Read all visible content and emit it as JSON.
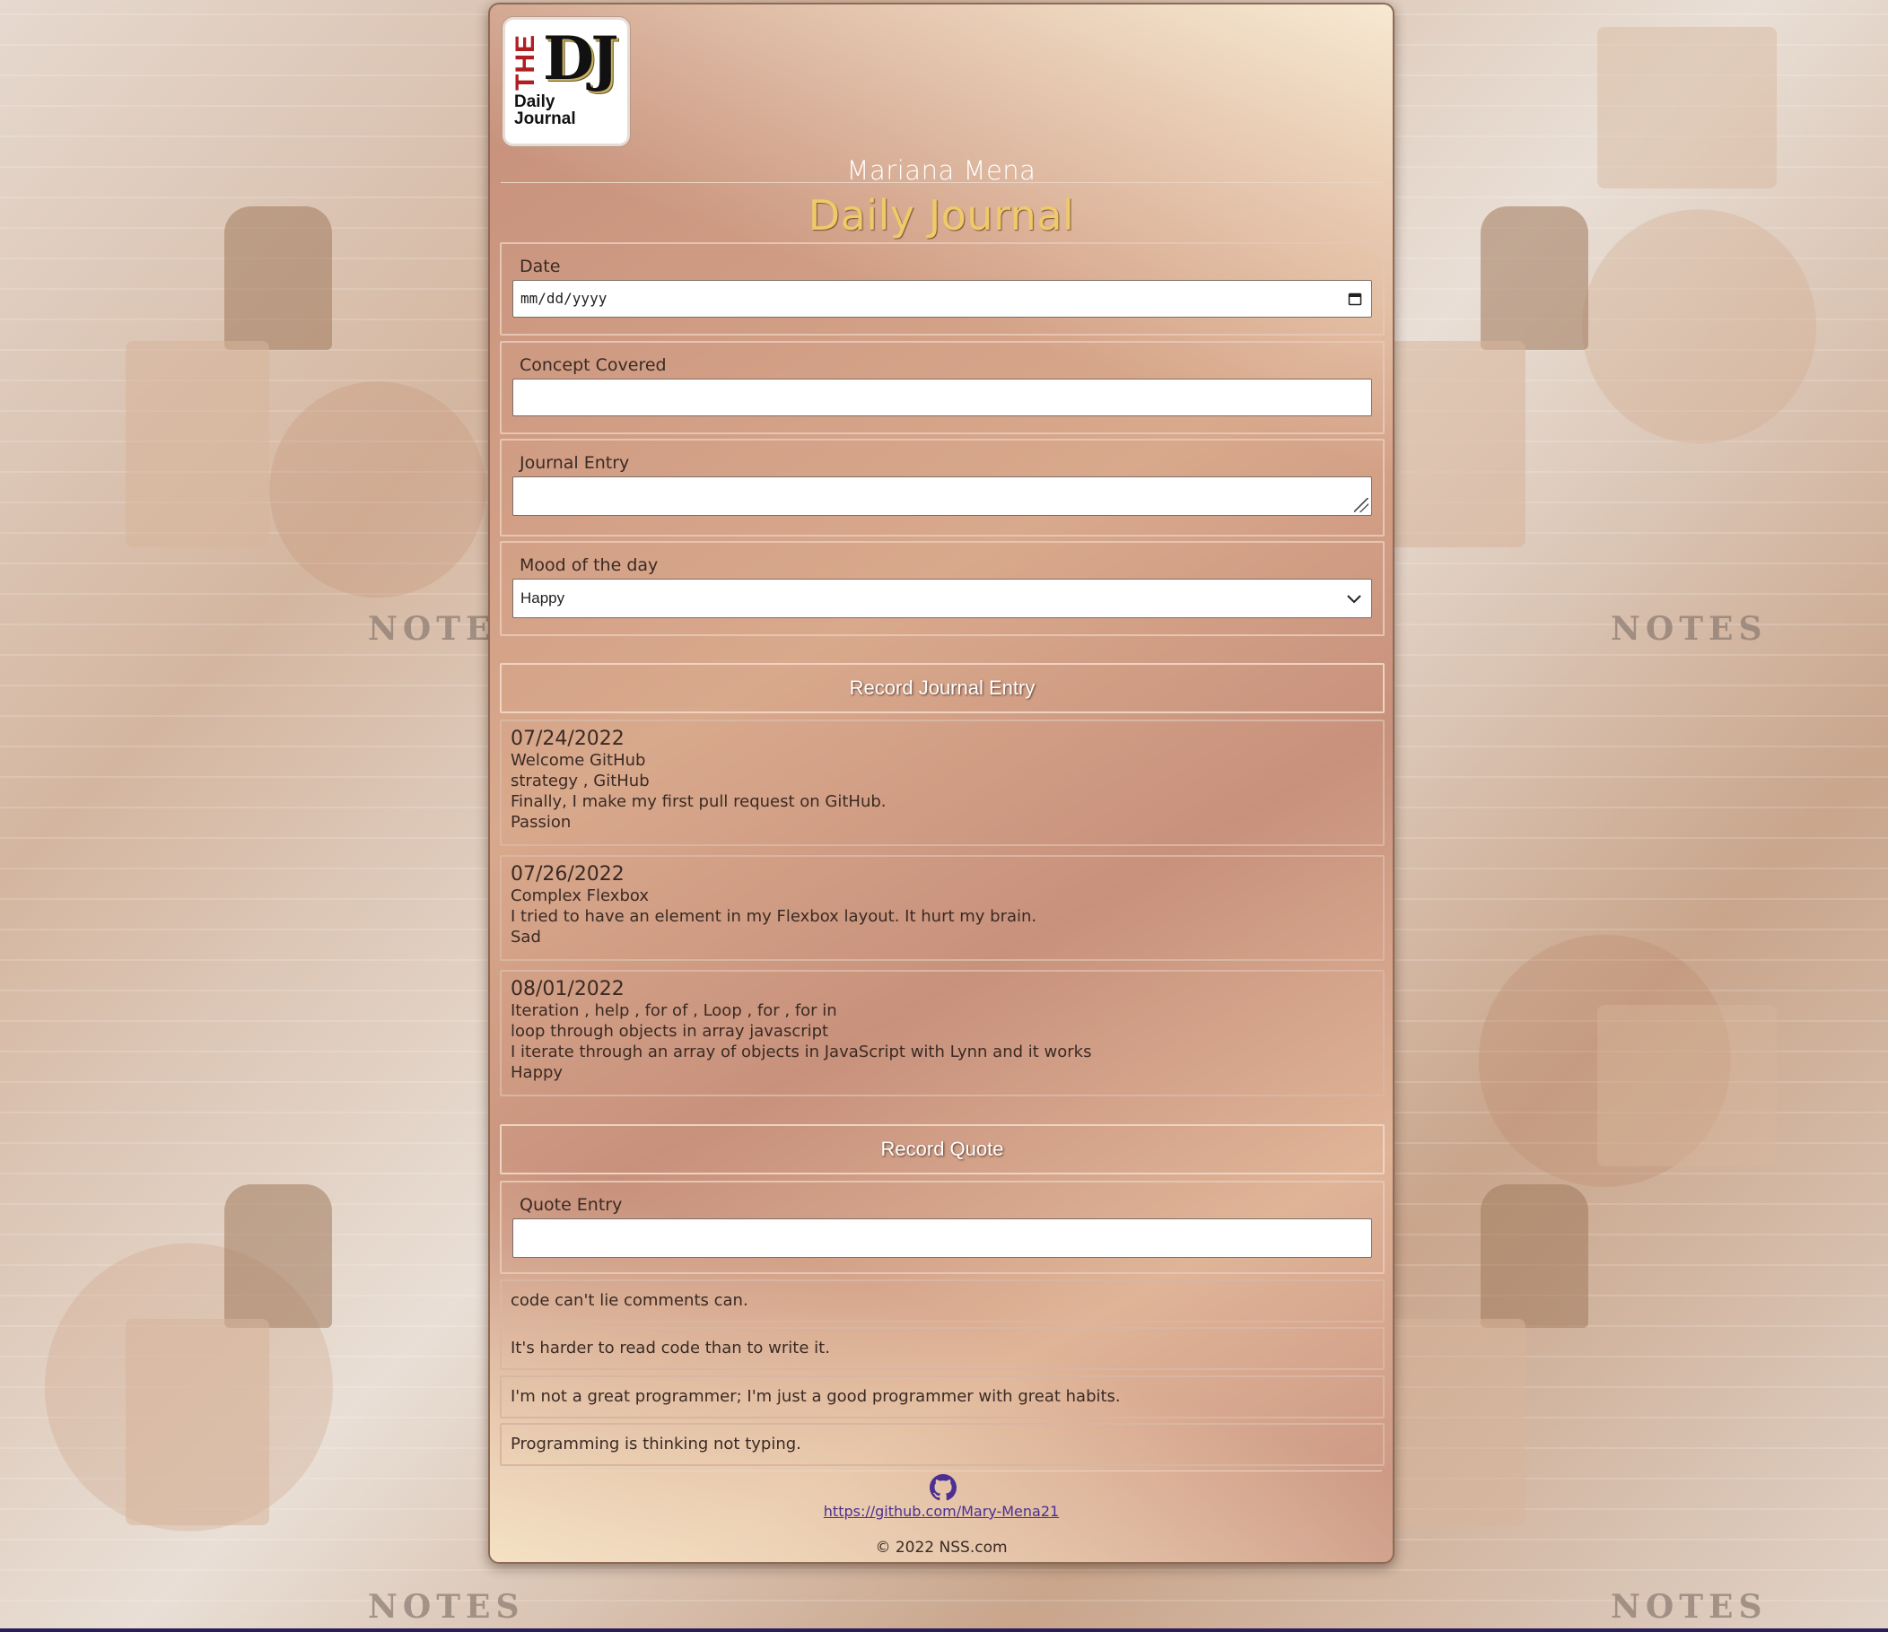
{
  "header": {
    "logo": {
      "the": "THE",
      "dj": "DJ",
      "daily": "Daily",
      "journal": "Journal"
    },
    "author": "Mariana Mena",
    "title": "Daily Journal"
  },
  "form": {
    "date": {
      "label": "Date",
      "placeholder": "mm/dd/yyyy"
    },
    "concept": {
      "label": "Concept Covered",
      "value": ""
    },
    "entry": {
      "label": "Journal Entry",
      "value": ""
    },
    "mood": {
      "label": "Mood of the day",
      "selected": "Happy"
    },
    "submit_label": "Record Journal Entry"
  },
  "entries": [
    {
      "date": "07/24/2022",
      "lines": [
        "Welcome GitHub",
        "strategy , GitHub",
        "Finally, I make my first pull request on GitHub.",
        "Passion"
      ]
    },
    {
      "date": "07/26/2022",
      "lines": [
        "Complex Flexbox",
        "I tried to have an element in my Flexbox layout. It hurt my brain.",
        "Sad"
      ]
    },
    {
      "date": "08/01/2022",
      "lines": [
        "Iteration , help , for of , Loop , for , for in",
        "loop through objects in array javascript",
        "I iterate through an array of objects in JavaScript with Lynn and it works",
        "Happy"
      ]
    }
  ],
  "quote_form": {
    "submit_label": "Record Quote",
    "label": "Quote Entry",
    "value": ""
  },
  "quotes": [
    "code can't lie comments can.",
    "It's harder to read code than to write it.",
    "I'm not a great programmer; I'm just a good programmer with great habits.",
    "Programming is thinking not typing."
  ],
  "footer": {
    "icon": "github-icon",
    "link": "https://github.com/Mary-Mena21",
    "copyright": "© 2022 NSS.com"
  },
  "colors": {
    "title": "#f0c96a",
    "link": "#4b2f93",
    "text": "#3a2a24"
  }
}
